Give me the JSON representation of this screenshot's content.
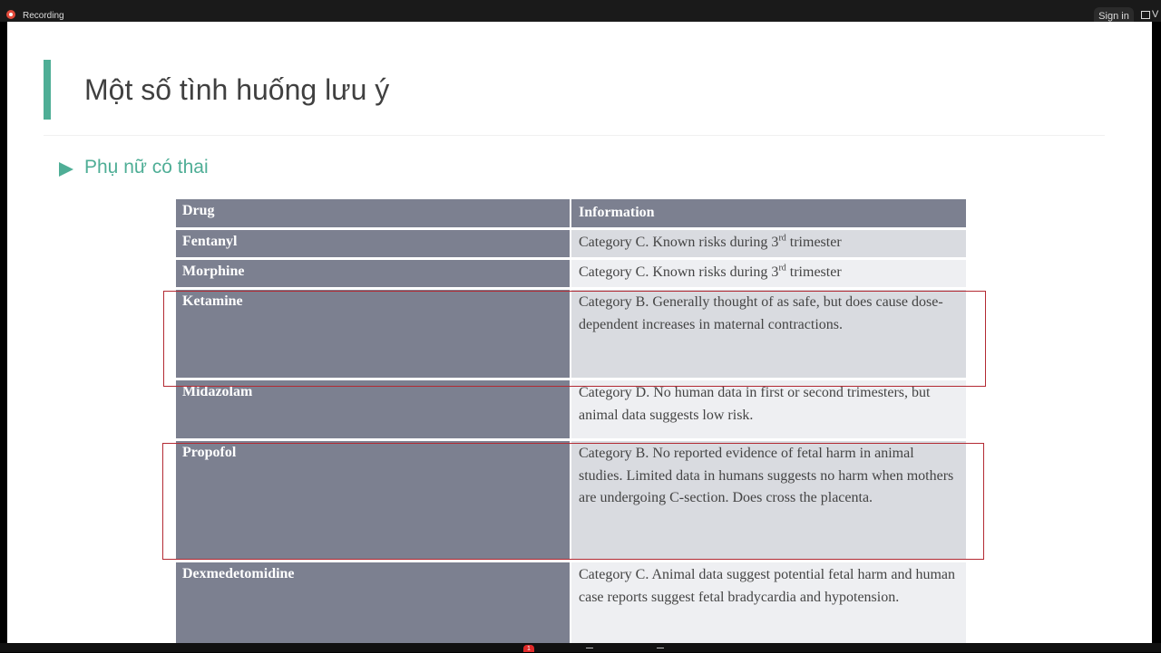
{
  "recording": {
    "label": "Recording"
  },
  "header": {
    "signin_label": "Sign in",
    "view_label": "V"
  },
  "slide": {
    "title": "Một số tình huống lưu ý",
    "bullet": "Phụ nữ có thai"
  },
  "table": {
    "headers": {
      "drug": "Drug",
      "info": "Information"
    },
    "rows": [
      {
        "drug": "Fentanyl",
        "info_pre": "Category C. Known risks during 3",
        "info_sup": "rd",
        "info_post": " trimester"
      },
      {
        "drug": "Morphine",
        "info_pre": "Category C. Known risks during 3",
        "info_sup": "rd",
        "info_post": " trimester"
      },
      {
        "drug": "Ketamine",
        "info": "Category B. Generally thought of as safe, but does cause dose-dependent increases in maternal contractions."
      },
      {
        "drug": "Midazolam",
        "info": "Category D. No human data in first or second trimesters, but animal data suggests low risk."
      },
      {
        "drug": "Propofol",
        "info": "Category B. No reported evidence of fetal harm in animal studies. Limited data in humans suggests no harm when mothers are undergoing C-section. Does cross the placenta."
      },
      {
        "drug": "Dexmedetomidine",
        "info": "Category C. Animal data suggest potential fetal harm and human case reports suggest fetal bradycardia and hypotension."
      }
    ]
  },
  "bottombar": {
    "badge_count": "1"
  },
  "colors": {
    "accent": "#4fae96",
    "drug_cell": "#7c8090",
    "highlight": "#b32a33",
    "recording": "#e24a3b"
  }
}
